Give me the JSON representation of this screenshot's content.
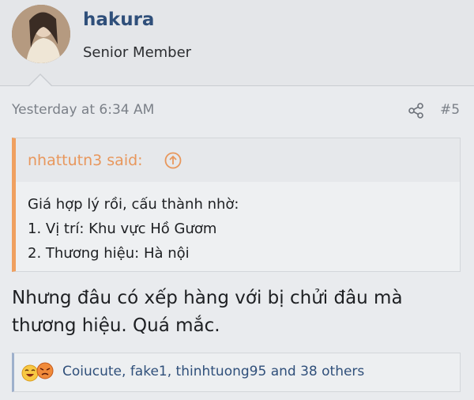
{
  "user": {
    "name": "hakura",
    "title": "Senior Member"
  },
  "post": {
    "time": "Yesterday at 6:34 AM",
    "number": "#5",
    "quote": {
      "author_line": "nhattutn3 said:",
      "lines": [
        "Giá hợp lý rồi, cấu thành nhờ:",
        "1. Vị trí: Khu vực Hồ Gươm",
        "2. Thương hiệu: Hà nội"
      ]
    },
    "message_lines": [
      "Nhưng đâu có xếp hàng với bị chửi đâu mà",
      "thương hiệu. Quá mắc."
    ],
    "reactions": {
      "text": "Coiucute, fake1, thinhtuong95 and 38 others",
      "icons": [
        "haha-face-icon",
        "angry-face-icon"
      ]
    }
  },
  "colors": {
    "accent_quote": "#f0a060",
    "link": "#2f4f7a"
  }
}
